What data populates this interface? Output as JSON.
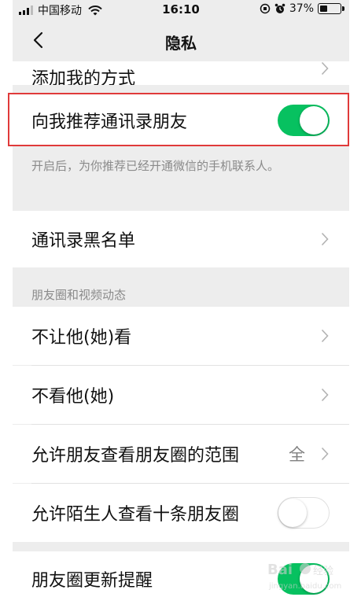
{
  "status_bar": {
    "carrier": "中国移动",
    "time": "16:10",
    "battery": "37%",
    "battery_level": 0.37
  },
  "nav": {
    "title": "隐私",
    "back_icon": "chevron-left-icon"
  },
  "rows": {
    "partial_top_label": "添加我的方式",
    "recommend_contacts": {
      "label": "向我推荐通讯录朋友",
      "toggle": true
    },
    "recommend_note": "开启后，为你推荐已经开通微信的手机联系人。",
    "blacklist": {
      "label": "通讯录黑名单"
    },
    "moments_section_header": "朋友圈和视频动态",
    "hide_my_moments": {
      "label": "不让他(她)看"
    },
    "hide_their_moments": {
      "label": "不看他(她)"
    },
    "moments_range": {
      "label": "允许朋友查看朋友圈的范围",
      "value": "全"
    },
    "strangers_view": {
      "label": "允许陌生人查看十条朋友圈",
      "toggle": false
    },
    "moments_updates": {
      "label": "朋友圈更新提醒",
      "toggle": true
    }
  },
  "colors": {
    "accent_green": "#07c160",
    "highlight_red": "#e03a3a",
    "background": "#ededed"
  }
}
